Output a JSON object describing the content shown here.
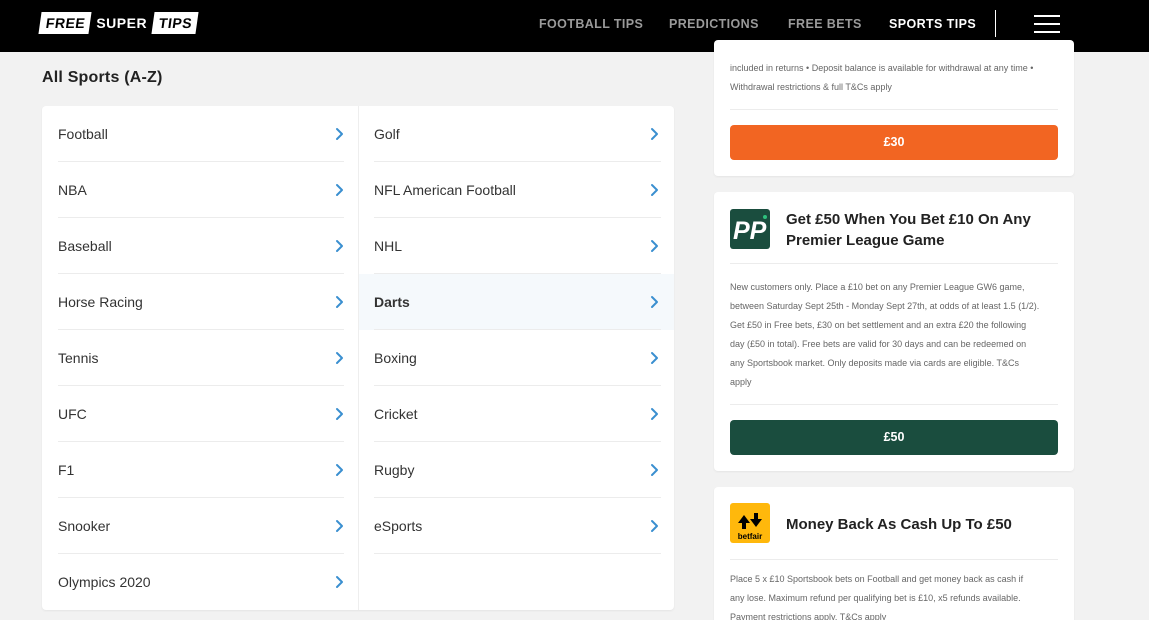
{
  "header": {
    "logo": {
      "part1": "FREE",
      "part2": "SUPER",
      "part3": "TIPS"
    },
    "nav": [
      "FOOTBALL TIPS",
      "PREDICTIONS",
      "FREE BETS",
      "SPORTS TIPS"
    ],
    "active_nav": "SPORTS TIPS"
  },
  "sports": {
    "title": "All Sports (A-Z)",
    "left_column": [
      "Football",
      "NBA",
      "Baseball",
      "Horse Racing",
      "Tennis",
      "UFC",
      "F1",
      "Snooker",
      "Olympics 2020"
    ],
    "right_column": [
      "Golf",
      "NFL American Football",
      "NHL",
      "Darts",
      "Boxing",
      "Cricket",
      "Rugby",
      "eSports"
    ],
    "highlighted": "Darts"
  },
  "offers": [
    {
      "terms_line1": "included in returns • Deposit balance is available for withdrawal at any time •",
      "terms_line2": "Withdrawal restrictions & full T&Cs apply",
      "button": "£30",
      "button_color": "#f26522"
    },
    {
      "brand_logo": "PP",
      "brand_color": "#1a4d3e",
      "title": "Get £50 When You Bet £10 On Any Premier League Game",
      "terms": [
        "New customers only. Place a £10 bet on any Premier League GW6 game,",
        "between Saturday Sept 25th - Monday Sept 27th, at odds of at least 1.5 (1/2).",
        "Get £50 in Free bets, £30 on bet settlement and an extra £20 the following",
        "day (£50 in total). Free bets are valid for 30 days and can be redeemed on",
        "any Sportsbook market. Only deposits made via cards are eligible. T&Cs",
        "apply"
      ],
      "button": "£50",
      "button_color": "#1a4d3e"
    },
    {
      "brand_logo": "betfair",
      "brand_color": "#ffb80c",
      "title": "Money Back As Cash Up To £50",
      "terms": [
        "Place 5 x £10 Sportsbook bets on Football and get money back as cash if",
        "any lose. Maximum refund per qualifying bet is £10, x5 refunds available.",
        "Payment restrictions apply. T&Cs apply"
      ]
    }
  ],
  "colors": {
    "header_bg": "#000000",
    "chevron": "#3a8fd0",
    "page_bg": "#f2f2f2"
  }
}
